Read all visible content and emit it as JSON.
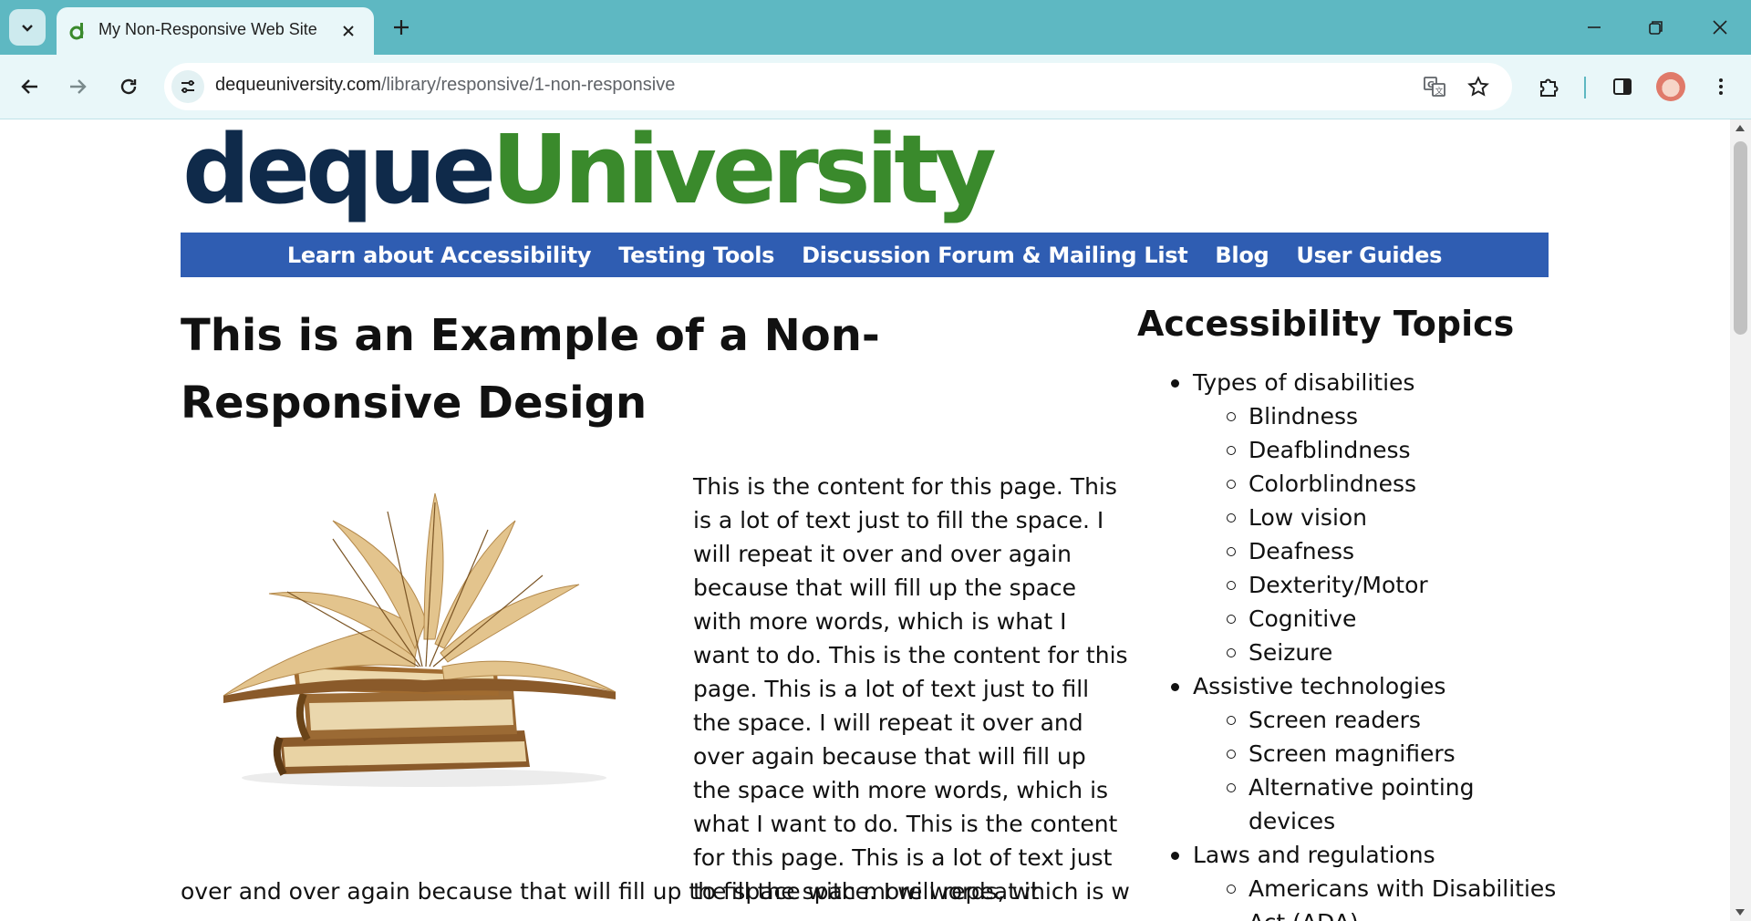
{
  "browser": {
    "tab_title": "My Non-Responsive Web Site",
    "url_host": "dequeuniversity.com",
    "url_path": "/library/responsive/1-non-responsive",
    "accent_color": "#5eb8c2"
  },
  "site": {
    "logo_part1": "deque",
    "logo_part2": "University",
    "nav": [
      "Learn about Accessibility",
      "Testing Tools",
      "Discussion Forum & Mailing List",
      "Blog",
      "User Guides"
    ],
    "nav_color": "#2f5db2"
  },
  "main": {
    "title": "This is an Example of a Non-Responsive Design",
    "image_description": "stack of old books with one open book on top",
    "paragraph_part1": "This is the content for this page. This is a lot of text just to fill the space. I will repeat it over and over again because that will fill up the space with more words, which is what I want to do. This is the content for this page. This is a lot of text just to fill the space. I will repeat it over and over again because that will fill up the space with more words, which is what I want to do. This is the content for this page. This is a lot of text just to fill the space. I will repeat it",
    "paragraph_part2": "over and over again because that will fill up the space with more words, which is what I"
  },
  "sidebar": {
    "heading": "Accessibility Topics",
    "topics": [
      {
        "label": "Types of disabilities",
        "items": [
          "Blindness",
          "Deafblindness",
          "Colorblindness",
          "Low vision",
          "Deafness",
          "Dexterity/Motor",
          "Cognitive",
          "Seizure"
        ]
      },
      {
        "label": "Assistive technologies",
        "items": [
          "Screen readers",
          "Screen magnifiers",
          "Alternative pointing devices"
        ]
      },
      {
        "label": "Laws and regulations",
        "items": [
          "Americans with Disabilities Act (ADA)"
        ]
      }
    ]
  }
}
